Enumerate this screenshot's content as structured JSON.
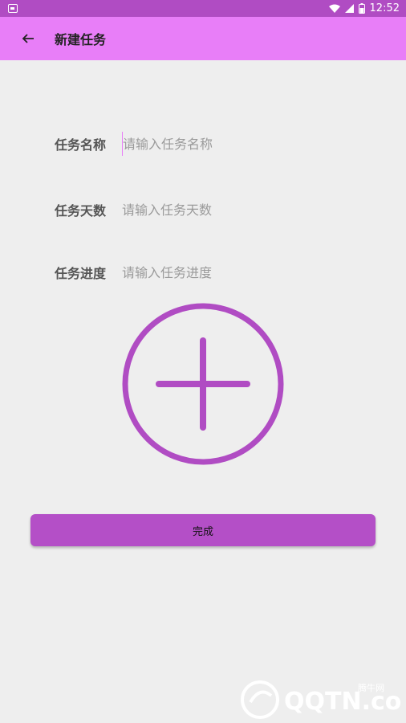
{
  "status_bar": {
    "time": "12:52",
    "icons": [
      "notification-icon",
      "wifi-icon",
      "signal-icon",
      "battery-icon"
    ]
  },
  "app_bar": {
    "title": "新建任务",
    "back_icon": "arrow-back-icon",
    "color": "#e87ef8"
  },
  "form": {
    "fields": [
      {
        "label": "任务名称",
        "placeholder": "请输入任务名称",
        "value": ""
      },
      {
        "label": "任务天数",
        "placeholder": "请输入任务天数",
        "value": ""
      },
      {
        "label": "任务进度",
        "placeholder": "请输入任务进度",
        "value": ""
      }
    ]
  },
  "add_button": {
    "icon": "add-circle-icon",
    "color": "#b04cc3"
  },
  "done_button": {
    "label": "完成",
    "color": "#b44fc7"
  },
  "watermark": {
    "site": "QQTN.com",
    "brand": "腾牛网"
  }
}
